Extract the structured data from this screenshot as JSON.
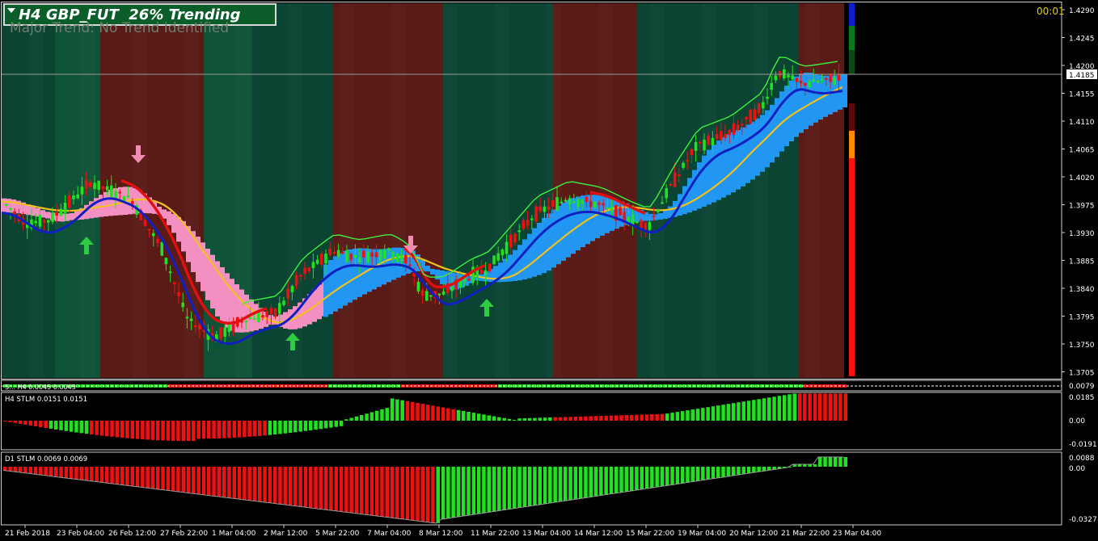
{
  "header": {
    "title": "H4 GBP_FUT  26% Trending",
    "subtitle": "Major Trend: No Trend Identified",
    "clock": "00:01"
  },
  "main_chart": {
    "price_axis": [
      "1.4290",
      "1.4245",
      "1.4200",
      "1.4155",
      "1.4110",
      "1.4065",
      "1.4020",
      "1.3975",
      "1.3930",
      "1.3885",
      "1.3840",
      "1.3795",
      "1.3750",
      "1.3705"
    ],
    "current_price": "1.4185",
    "arrows": [
      {
        "type": "up",
        "color": "#2ecc40"
      },
      {
        "type": "down",
        "color": "#f28cb0"
      },
      {
        "type": "up",
        "color": "#2ecc40"
      },
      {
        "type": "down",
        "color": "#f28cb0"
      },
      {
        "type": "up",
        "color": "#2ecc40"
      }
    ]
  },
  "strip_panel": {
    "label": "S… H4 0.0045 0.0045",
    "axis": [
      "0.0079"
    ]
  },
  "h4_stlm": {
    "label": "H4 STLM 0.0151 0.0151",
    "axis": [
      "0.0185",
      "0.00",
      "-0.0191"
    ]
  },
  "d1_stlm": {
    "label": "D1 STLM 0.0069 0.0069",
    "axis": [
      "0.0088",
      "0.00",
      "-0.0327"
    ]
  },
  "time_axis": [
    "21 Feb 2018",
    "23 Feb 04:00",
    "26 Feb 12:00",
    "27 Feb 22:00",
    "1 Mar 04:00",
    "2 Mar 12:00",
    "5 Mar 22:00",
    "7 Mar 04:00",
    "8 Mar 12:00",
    "11 Mar 22:00",
    "13 Mar 04:00",
    "14 Mar 12:00",
    "15 Mar 22:00",
    "19 Mar 04:00",
    "20 Mar 12:00",
    "21 Mar 22:00",
    "23 Mar 04:00"
  ],
  "colors": {
    "bg": "#000000",
    "zone_green": "#0b4433",
    "zone_green_alt": "#0e5238",
    "zone_red": "#5a1a16",
    "bull": "#22e022",
    "bear": "#ee1111",
    "cloud_blue": "#2196f3",
    "cloud_pink": "#f48fc1",
    "ma_yellow": "#f0c020",
    "line_blue": "#1020c0",
    "line_red": "#e01010"
  }
}
